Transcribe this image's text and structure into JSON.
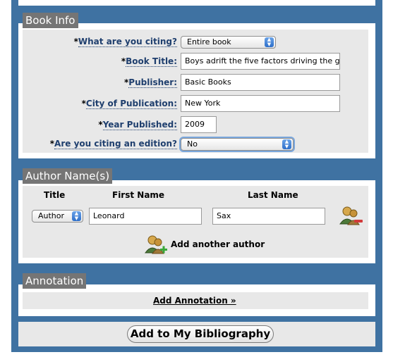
{
  "book_info": {
    "section_title": "Book Info",
    "citing": {
      "label": "What are you citing?",
      "value": "Entire book"
    },
    "title": {
      "label": "Book Title:",
      "value": "Boys adrift the five factors driving the gr"
    },
    "publisher": {
      "label": "Publisher:",
      "value": "Basic Books"
    },
    "city": {
      "label": "City of Publication:",
      "value": "New York"
    },
    "year": {
      "label": "Year Published:",
      "value": "2009"
    },
    "edition": {
      "label": "Are you citing an edition?",
      "value": "No"
    },
    "required_mark": "*"
  },
  "authors": {
    "section_title": "Author Name(s)",
    "col_title": "Title",
    "col_first": "First Name",
    "col_last": "Last Name",
    "row": {
      "title": "Author",
      "first": "Leonard",
      "last": "Sax"
    },
    "add_label": "Add another author"
  },
  "annotation": {
    "section_title": "Annotation",
    "link": "Add Annotation »"
  },
  "submit_label": "Add to My Bibliography",
  "colors": {
    "frame": "#3f72a2",
    "panel_bg": "#e8e8e8",
    "title_bg": "#757575",
    "label_link": "#1f3f6e"
  },
  "icons": {
    "remove_author": "person-remove-icon",
    "add_author": "people-add-icon",
    "select_arrows": "updown-arrows-icon"
  }
}
